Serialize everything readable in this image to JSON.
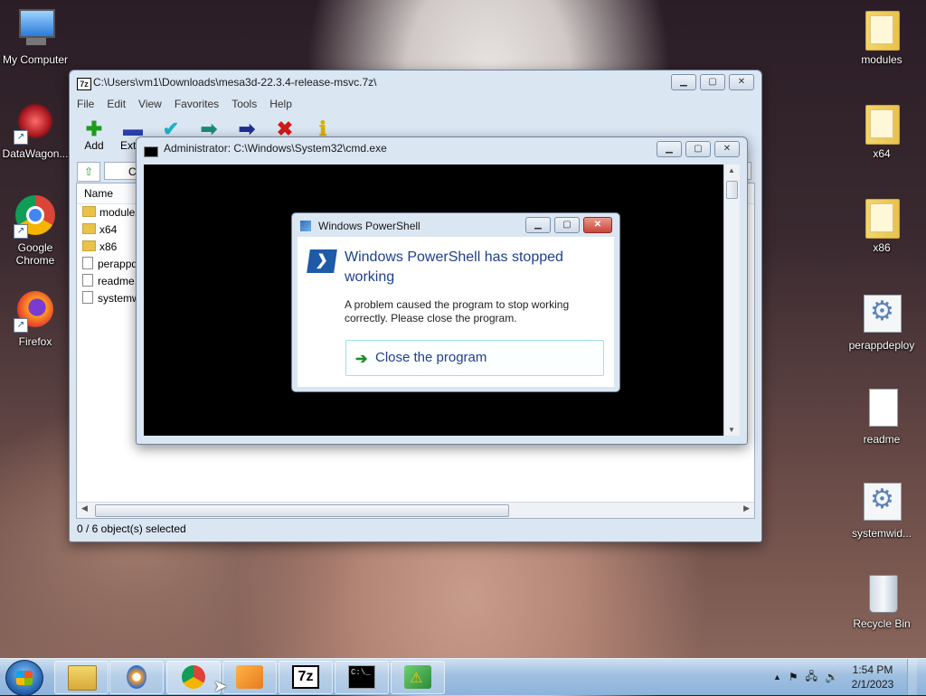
{
  "desktop": {
    "left_icons": [
      {
        "label": "My Computer",
        "icon": "computer-icon"
      },
      {
        "label": "DataWagon...",
        "icon": "datawagon-icon"
      },
      {
        "label": "Google Chrome",
        "icon": "chrome-icon"
      },
      {
        "label": "Firefox",
        "icon": "firefox-icon"
      }
    ],
    "right_icons": [
      {
        "label": "modules",
        "icon": "folder-icon"
      },
      {
        "label": "x64",
        "icon": "folder-icon"
      },
      {
        "label": "x86",
        "icon": "folder-icon"
      },
      {
        "label": "perappdeploy",
        "icon": "settings-file-icon"
      },
      {
        "label": "readme",
        "icon": "text-file-icon"
      },
      {
        "label": "systemwid...",
        "icon": "settings-file-icon"
      },
      {
        "label": "Recycle Bin",
        "icon": "recycle-bin-icon"
      }
    ]
  },
  "sevenzip": {
    "title": "C:\\Users\\vm1\\Downloads\\mesa3d-22.3.4-release-msvc.7z\\",
    "menu": [
      "File",
      "Edit",
      "View",
      "Favorites",
      "Tools",
      "Help"
    ],
    "toolbar": [
      {
        "label": "Add",
        "icon": "add-icon",
        "color": "#1a9e1a"
      },
      {
        "label": "Extra",
        "icon": "extract-icon",
        "color": "#2a3fb0"
      },
      {
        "label": "",
        "icon": "test-icon",
        "color": "#1bb3c8"
      },
      {
        "label": "",
        "icon": "copy-icon",
        "color": "#1a8a7a"
      },
      {
        "label": "",
        "icon": "move-icon",
        "color": "#1f2f8f"
      },
      {
        "label": "",
        "icon": "delete-icon",
        "color": "#d11a1a"
      },
      {
        "label": "",
        "icon": "info-icon",
        "color": "#d9b000"
      }
    ],
    "address_text": "C:",
    "column_name": "Name",
    "files": [
      {
        "name": "modules",
        "type": "folder"
      },
      {
        "name": "x64",
        "type": "folder"
      },
      {
        "name": "x86",
        "type": "folder"
      },
      {
        "name": "perappd",
        "type": "file"
      },
      {
        "name": "readme.",
        "type": "file"
      },
      {
        "name": "systemw",
        "type": "file"
      }
    ],
    "status": "0 / 6 object(s) selected"
  },
  "cmd": {
    "title": "Administrator: C:\\Windows\\System32\\cmd.exe"
  },
  "powershell_dialog": {
    "title": "Windows PowerShell",
    "headline": "Windows PowerShell has stopped working",
    "message": "A problem caused the program to stop working correctly. Please close the program.",
    "action": "Close the program"
  },
  "taskbar": {
    "apps": [
      {
        "icon": "explorer-icon"
      },
      {
        "icon": "media-player-icon"
      },
      {
        "icon": "chrome-icon"
      },
      {
        "icon": "datawagon-icon"
      },
      {
        "icon": "7zip-icon",
        "text": "7z"
      },
      {
        "icon": "cmd-icon",
        "text": "C:\\_"
      },
      {
        "icon": "powershell-warning-icon"
      }
    ],
    "time": "1:54 PM",
    "date": "2/1/2023"
  }
}
